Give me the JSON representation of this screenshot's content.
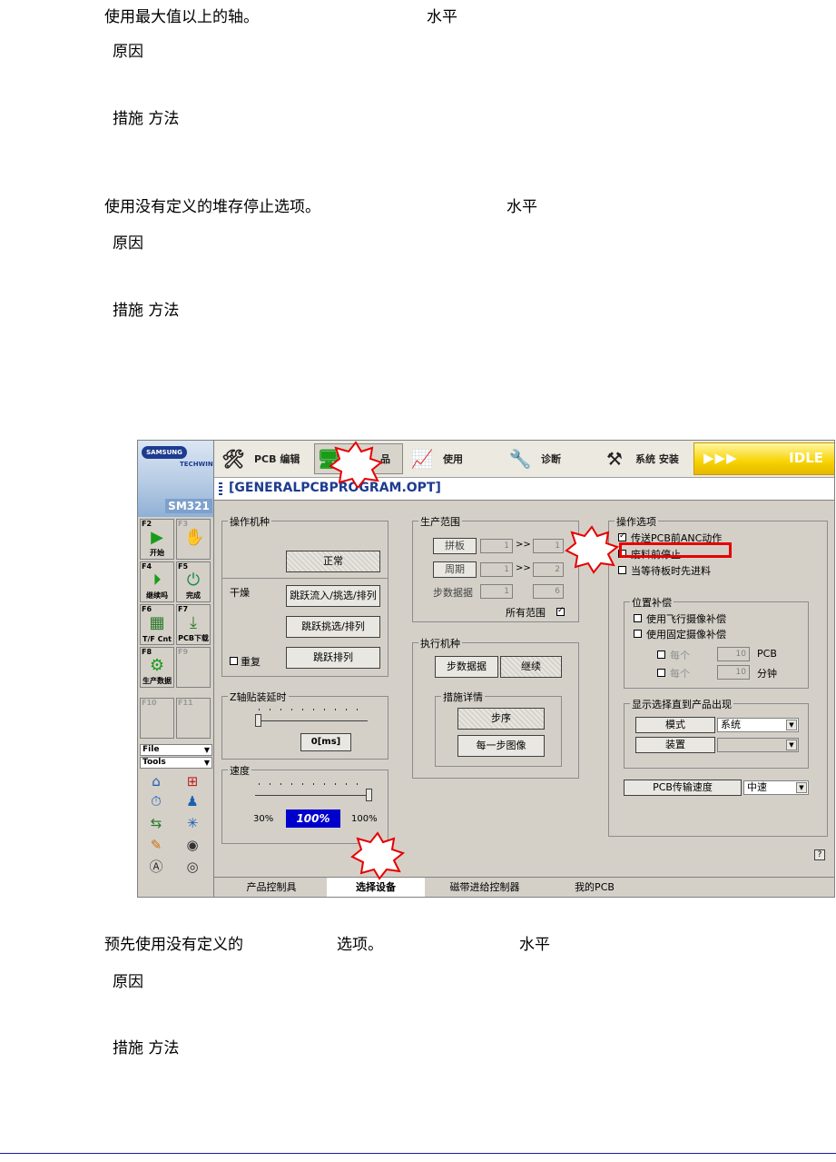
{
  "doc": {
    "sec1_title": "使用最大值以上的轴。",
    "sec1_level": "水平",
    "sec1_cause": "原因",
    "sec1_action": "措施  方法",
    "sec2_title": "使用没有定义的堆存停止选项。",
    "sec2_level": "水平",
    "sec2_cause": "原因",
    "sec2_action": "措施  方法",
    "sec3_title": "预先使用没有定义的",
    "sec3_title_b": "选项。",
    "sec3_level": "水平",
    "sec3_cause": "原因",
    "sec3_action": "措施  方法"
  },
  "screen": {
    "brand": {
      "logo": "SAMSUNG",
      "sub": "TECHWIN",
      "model": "SM321"
    },
    "fkeys": [
      {
        "key": "F2",
        "label": "开始"
      },
      {
        "key": "F3",
        "label": ""
      },
      {
        "key": "F4",
        "label": "继续吗"
      },
      {
        "key": "F5",
        "label": "完成"
      },
      {
        "key": "F6",
        "label": "T/F Cnt"
      },
      {
        "key": "F7",
        "label": "PCB下载"
      },
      {
        "key": "F8",
        "label": "生产数据"
      },
      {
        "key": "F9",
        "label": ""
      },
      {
        "key": "F10",
        "label": ""
      },
      {
        "key": "F11",
        "label": ""
      }
    ],
    "dropdowns": {
      "file": "File",
      "tools": "Tools"
    },
    "toolbar": {
      "pcb_edit": "PCB 编辑",
      "active": "品",
      "use": "使用",
      "diagnose": "诊断",
      "system_setup": "系统 安装",
      "arrows": "▶▶▶",
      "status": "IDLE"
    },
    "path": "[GENERALPCBPROGRAM.OPT]",
    "operation_mode": {
      "title": "操作机种",
      "normal_btn": "正常",
      "dry_label": "干燥",
      "skip_flow_btn": "跳跃流入/挑选/排列",
      "skip_pick_btn": "跳跃挑选/排列",
      "skip_array_btn": "跳跃排列",
      "repeat_label": "重复"
    },
    "z_delay": {
      "title": "Z轴贴装延时",
      "value": "0[ms]"
    },
    "speed": {
      "title": "速度",
      "min": "30%",
      "current": "100%",
      "max": "100%",
      "level": 1.0
    },
    "production_range": {
      "title": "生产范围",
      "panel_label": "拼板",
      "panel_from": "1",
      "panel_to": "1",
      "cycle_label": "周期",
      "cycle_from": "1",
      "cycle_to": "2",
      "step_label": "步数据据",
      "step_from": "1",
      "step_to": "6",
      "sep": ">>",
      "all_range_label": "所有范围"
    },
    "exec_mode": {
      "title": "执行机种",
      "step_data_btn": "步数据据",
      "continue_btn": "继续",
      "detail_title": "措施详情",
      "step_btn": "步序",
      "each_step_image_btn": "每一步图像"
    },
    "op_options": {
      "title": "操作选项",
      "opt1": "传送PCB前ANC动作",
      "opt2": "废料前停止",
      "opt3": "当等待板时先进料"
    },
    "position_comp": {
      "title": "位置补偿",
      "opt1": "使用飞行摄像补偿",
      "opt2": "使用固定摄像补偿",
      "each_label": "每个",
      "pcb_value": "10",
      "pcb_unit": "PCB",
      "min_value": "10",
      "min_unit": "分钟"
    },
    "display_select": {
      "title": "显示选择直到产品出现",
      "mode_label": "模式",
      "mode_value": "系统",
      "device_label": "装置",
      "device_value": ""
    },
    "pcb_speed": {
      "label": "PCB传输速度",
      "value": "中速"
    },
    "help": "?",
    "tabs": [
      "产品控制具",
      "选择设备",
      "磁带进给控制器",
      "我的PCB"
    ]
  },
  "colors": {
    "accent_red": "#e60000",
    "brand_blue": "#1d3c8f",
    "status_yellow": "#f7d200",
    "speed_blue": "#0000cc"
  }
}
